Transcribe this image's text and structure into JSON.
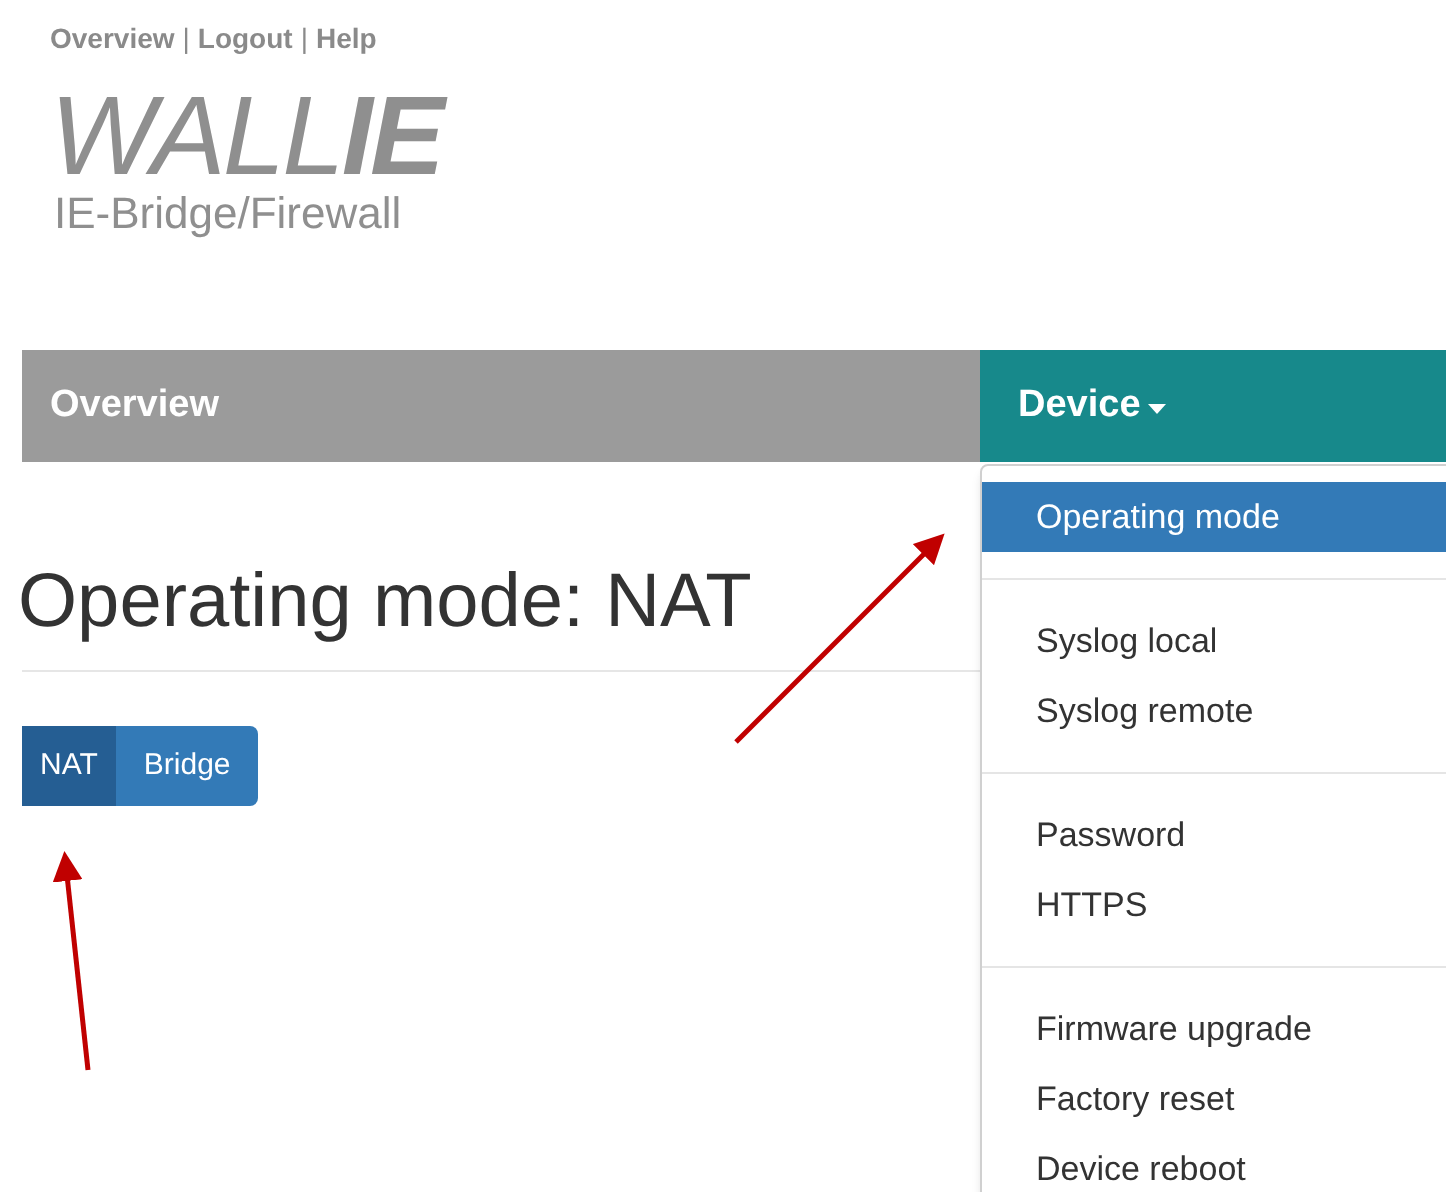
{
  "top_links": [
    {
      "kind": "link",
      "text": "Overview"
    },
    {
      "kind": "separator",
      "text": "|"
    },
    {
      "kind": "link",
      "text": "Logout"
    },
    {
      "kind": "separator",
      "text": "|"
    },
    {
      "kind": "link",
      "text": "Help"
    }
  ],
  "logo": {
    "part_1": "WALL",
    "part_2": "IE",
    "subtitle": "IE-Bridge/Firewall"
  },
  "nav": [
    {
      "label": "Overview",
      "selected": false,
      "dropdown": false
    },
    {
      "label": "Device",
      "selected": true,
      "dropdown": true
    }
  ],
  "menu": {
    "groups": [
      [
        {
          "label": "Operating mode",
          "selected": true
        }
      ],
      [
        {
          "label": "Syslog local",
          "selected": false
        },
        {
          "label": "Syslog remote",
          "selected": false
        }
      ],
      [
        {
          "label": "Password",
          "selected": false
        },
        {
          "label": "HTTPS",
          "selected": false
        }
      ],
      [
        {
          "label": "Firmware upgrade",
          "selected": false
        },
        {
          "label": "Factory reset",
          "selected": false
        },
        {
          "label": "Device reboot",
          "selected": false
        }
      ]
    ]
  },
  "heading": "Operating mode: NAT",
  "mode_buttons": [
    {
      "label": "NAT",
      "selected": true
    },
    {
      "label": "Bridge",
      "selected": false
    }
  ]
}
